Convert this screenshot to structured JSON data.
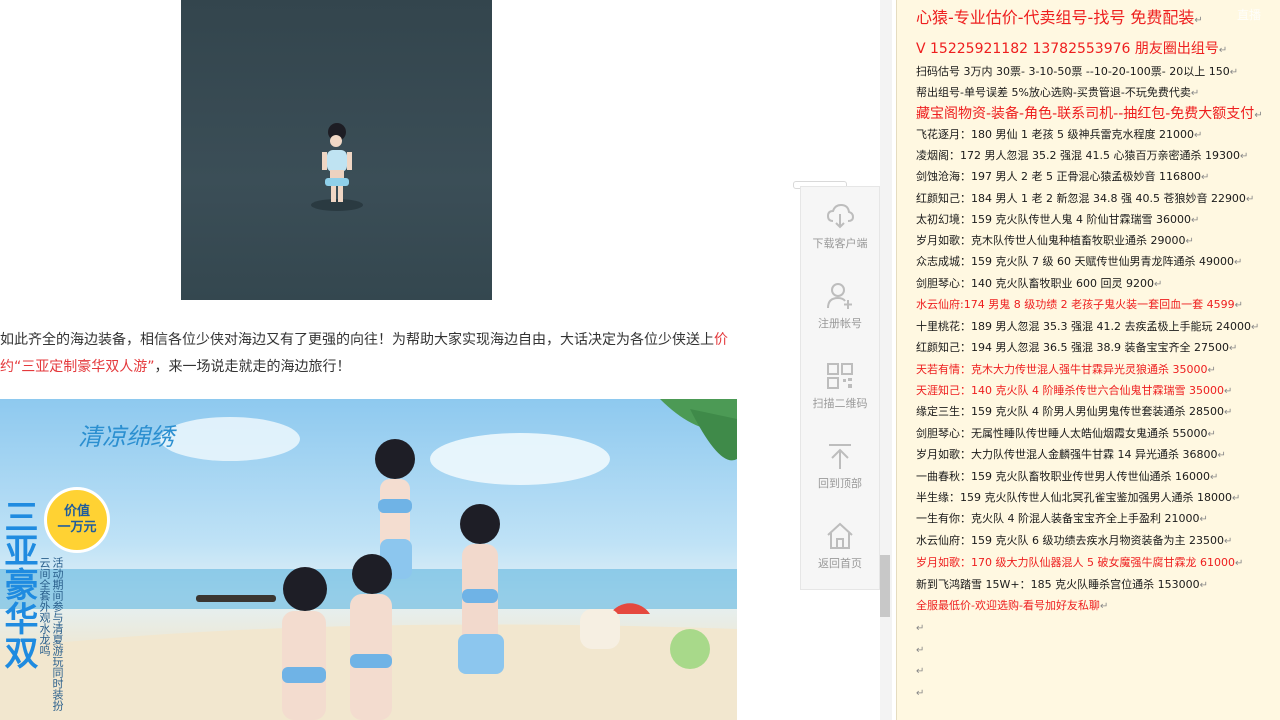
{
  "article": {
    "para1_black": "如此齐全的海边装备，相信各位少侠对海边又有了更强的向往！为帮助大家实现海边自由，大话决定为各位少侠送上",
    "para1_red": "价",
    "para2_red": "约“三亚定制豪华双人游”",
    "para2_black": "，来一场说走就走的海边旅行！",
    "banner": {
      "logo_text": "清凉绵绣",
      "badge_line1": "价值",
      "badge_line2": "一万元",
      "vertical_title": "三亚豪华双",
      "vertical_text": "活动期间参与清夏游玩同时装扮云间全套外观水龙鸣"
    }
  },
  "float_sidebar": {
    "items": [
      {
        "label": "下载客户端",
        "icon": "cloud-download-icon"
      },
      {
        "label": "注册帐号",
        "icon": "user-add-icon"
      },
      {
        "label": "扫描二维码",
        "icon": "qr-code-icon"
      },
      {
        "label": "回到顶部",
        "icon": "back-to-top-icon"
      },
      {
        "label": "返回首页",
        "icon": "home-icon"
      }
    ]
  },
  "notes": {
    "para_mark": "↵",
    "lines": [
      {
        "text": "心猿-专业估价-代卖组号-找号 免费配装",
        "style": "rd big"
      },
      {
        "text": "V 15225921182   13782553976 朋友圈出组号",
        "style": "rd mid"
      },
      {
        "text": "扫码估号 3万内 30票- 3-10-50票  --10-20-100票- 20以上 150",
        "style": ""
      },
      {
        "text": "帮出组号-单号误差 5%放心选购-买贵管退-不玩免费代卖",
        "style": ""
      },
      {
        "text": "藏宝阁物资-装备-角色-联系司机--抽红包-免费大额支付",
        "style": "rd mid"
      },
      {
        "text": "飞花逐月：180 男仙 1 老孩 5 级神兵雷克水程度 21000",
        "style": ""
      },
      {
        "text": "凌烟阁：172 男人忽混 35.2 强混 41.5 心猿百万亲密通杀 19300",
        "style": ""
      },
      {
        "text": "剑蚀沧海：197 男人 2 老 5 正骨混心猿孟极妙音 116800",
        "style": ""
      },
      {
        "text": "红颜知己：184 男人 1 老 2 新忽混 34.8 强 40.5 苍狼妙音 22900",
        "style": ""
      },
      {
        "text": "太初幻境：159 克火队传世人鬼 4 阶仙甘霖瑞雪 36000",
        "style": ""
      },
      {
        "text": "岁月如歌：克木队传世人仙鬼种植畜牧职业通杀 29000",
        "style": ""
      },
      {
        "text": "众志成城：159 克火队 7 级 60 天赋传世仙男青龙阵通杀 49000",
        "style": ""
      },
      {
        "text": "剑胆琴心：140 克火队畜牧职业 600 回灵 9200",
        "style": ""
      },
      {
        "text": "水云仙府:174 男鬼 8 级功绩 2 老孩子鬼火装一套回血一套 4599",
        "style": "rd"
      },
      {
        "text": "十里桃花：189 男人忽混 35.3 强混 41.2 去疾孟极上手能玩 24000",
        "style": ""
      },
      {
        "text": "红颜知己：194 男人忽混 36.5 强混 38.9 装备宝宝齐全 27500",
        "style": ""
      },
      {
        "text": "天若有情：克木大力传世混人强牛甘霖异光灵狼通杀 35000",
        "style": "rd"
      },
      {
        "text": "天涯知己：140 克火队 4 阶睡杀传世六合仙鬼甘霖瑞雪 35000",
        "style": "rd"
      },
      {
        "text": "缘定三生：159 克火队 4 阶男人男仙男鬼传世套装通杀 28500",
        "style": ""
      },
      {
        "text": "剑胆琴心：无属性睡队传世睡人太皓仙烟霞女鬼通杀 55000",
        "style": ""
      },
      {
        "text": "岁月如歌：大力队传世混人金麟强牛甘霖 14 异光通杀 36800",
        "style": ""
      },
      {
        "text": "一曲春秋：159 克火队畜牧职业传世男人传世仙通杀 16000",
        "style": ""
      },
      {
        "text": "半生缘：159 克火队传世人仙北冥孔雀宝鉴加强男人通杀 18000",
        "style": ""
      },
      {
        "text": "一生有你：克火队 4 阶混人装备宝宝齐全上手盈利 21000",
        "style": ""
      },
      {
        "text": "水云仙府：159 克火队 6 级功绩去疾水月物资装备为主 23500",
        "style": ""
      },
      {
        "text": "岁月如歌：170 级大力队仙器混人 5 破女魔强牛腐甘霖龙 61000",
        "style": "rd"
      },
      {
        "text": "新到飞鸿踏雪 15W+：185 克火队睡杀宫位通杀 153000",
        "style": ""
      },
      {
        "text": "全服最低价-欢迎选购-看号加好友私聊",
        "style": "rd"
      },
      {
        "text": "",
        "style": ""
      },
      {
        "text": "",
        "style": ""
      },
      {
        "text": "",
        "style": ""
      },
      {
        "text": "",
        "style": ""
      }
    ],
    "watermark": "直播"
  },
  "colors": {
    "red_text": "#ee1e1e",
    "note_bg": "#fff8e1",
    "article_red": "#e4393c"
  }
}
